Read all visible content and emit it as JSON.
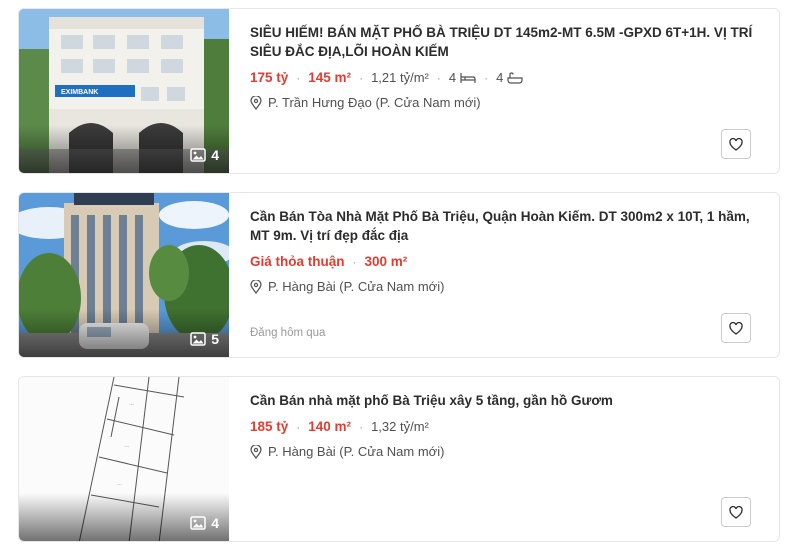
{
  "listings": [
    {
      "title": "SIÊU HIẾM! BÁN MẶT PHỐ BÀ TRIỆU DT 145m2-MT 6.5M -GPXD 6T+1H. VỊ TRÍ SIÊU ĐẮC ĐỊA,LÕI HOÀN KIẾM",
      "price": "175 tỷ",
      "area": "145 m²",
      "price_per_m2": "1,21 tỷ/m²",
      "bedrooms": "4",
      "bathrooms": "4",
      "location": "P. Trần Hưng Đạo (P. Cửa Nam mới)",
      "photo_count": "4",
      "bank_sign": "EXIMBANK"
    },
    {
      "title": "Cần Bán Tòa Nhà Mặt Phố Bà Triệu, Quận Hoàn Kiếm. DT 300m2 x 10T, 1 hầm, MT 9m. Vị trí đẹp đắc địa",
      "price": "Giá thỏa thuận",
      "area": "300 m²",
      "location": "P. Hàng Bài (P. Cửa Nam mới)",
      "posted": "Đăng hôm qua",
      "photo_count": "5"
    },
    {
      "title": "Cần Bán nhà mặt phố Bà Triệu xây 5 tầng, gần hồ Gươm",
      "price": "185 tỷ",
      "area": "140 m²",
      "price_per_m2": "1,32 tỷ/m²",
      "location": "P. Hàng Bài (P. Cửa Nam mới)",
      "photo_count": "4"
    }
  ],
  "colors": {
    "price": "#e03c31",
    "text": "#2c2c2c",
    "muted": "#505050"
  }
}
